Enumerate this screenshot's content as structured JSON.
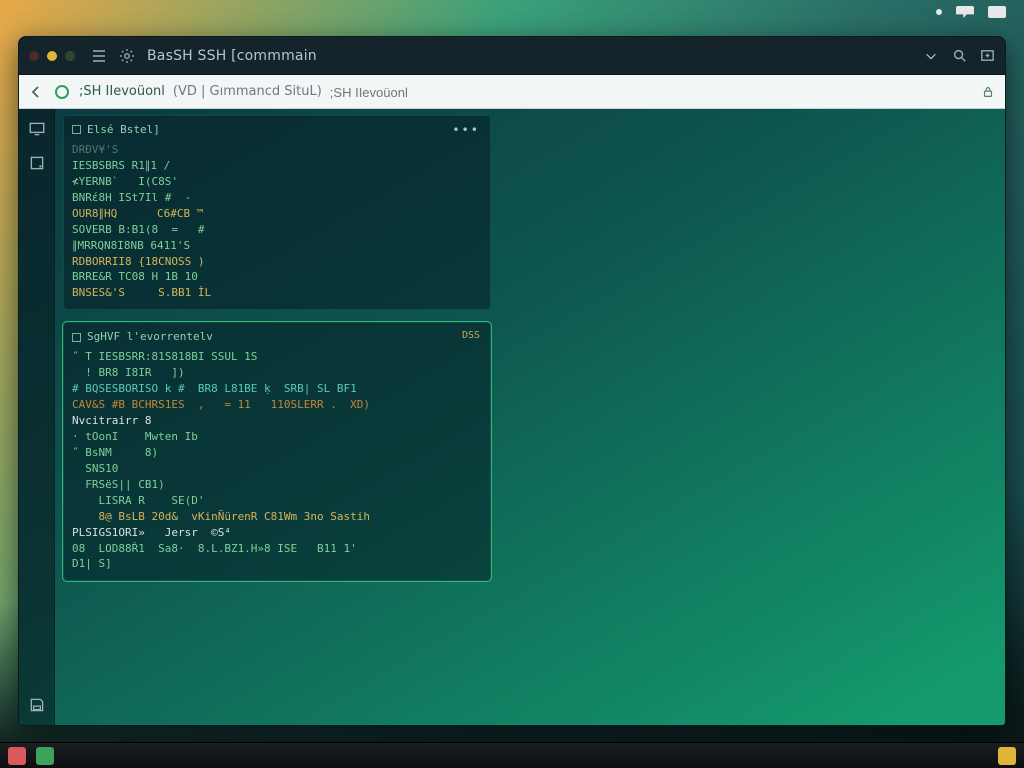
{
  "systray": {
    "items": [
      "dot",
      "chat",
      "screen"
    ]
  },
  "window": {
    "titlebar": {
      "title": "BasSH SSH [commmain",
      "icons": {
        "menu": "hamburger-icon",
        "gear": "gear-icon",
        "dropdown": "chevron-down-icon",
        "search": "search-icon",
        "newtab": "new-tab-icon"
      }
    },
    "addrbar": {
      "back": "back",
      "text_a": ";SH IIevoüonl",
      "text_b": "(VD | Gımmancd SituL)",
      "right_icon": "lock-icon"
    },
    "rail": {
      "items": [
        "monitor-icon",
        "disk-icon"
      ],
      "bottom": "save-icon"
    },
    "panes": [
      {
        "id": "p1",
        "title": "Elsé Bstel]",
        "menu": "...",
        "lines": [
          {
            "cls": "c-dim",
            "t": "DRÐV¥'S"
          },
          {
            "cls": "c-grn",
            "t": "IESBSBRS R1∥1 /"
          },
          {
            "cls": "c-grn",
            "t": "≮YERNB`   I(C8S'"
          },
          {
            "cls": "c-grn",
            "t": "BNRέ8H ISt7Il #  -"
          },
          {
            "cls": "c-yel",
            "t": "OUR8∥HQ      C6#CB ™"
          },
          {
            "cls": "c-grn",
            "t": "SOVERB B:B1(8  =   #"
          },
          {
            "cls": "c-grn",
            "t": "∥MRRQN8I8NB 6411'S"
          },
          {
            "cls": "c-yel",
            "t": "RDBORRII8 {18CNOSS )"
          },
          {
            "cls": "c-grn",
            "t": "BRRE&R TC08 H 1B 10"
          },
          {
            "cls": "c-yel",
            "t": "BNSES&'S     S.BB1 ÌL"
          }
        ]
      },
      {
        "id": "p2",
        "title": "SgHVF l'evorrentelv",
        "badge": "DSS",
        "lines": [
          {
            "cls": "c-grn",
            "t": "˝ T IESBSRR:81S818BI SSUL 1S"
          },
          {
            "cls": "c-grn",
            "t": "  ! BR8 I8IR   ])"
          },
          {
            "cls": "c-dim",
            "t": ""
          },
          {
            "cls": "c-cyan",
            "t": "# BQSESBORISO k #  BR8 L81BE ḳ  SRB| SL BF1"
          },
          {
            "cls": "c-org",
            "t": "CAV&S #B BCHRS1ES  ,   = 11   110SLERR .  XD)"
          },
          {
            "cls": "c-white",
            "t": "Nvcitrairr 8"
          },
          {
            "cls": "c-grn",
            "t": "· tOonI    Mwten Ib"
          },
          {
            "cls": "c-grn",
            "t": "˝ BsNM     8)"
          },
          {
            "cls": "c-grn",
            "t": "  SNS10"
          },
          {
            "cls": "c-grn",
            "t": "  FRSëS|| CB1)"
          },
          {
            "cls": "c-grn",
            "t": "    LISRA R    SE(D'"
          },
          {
            "cls": "c-yel",
            "t": "    8@ BsLB 20d&  vKinÑürenR C81Wm 3no Sastih"
          },
          {
            "cls": "c-white",
            "t": "PLSIGS1ORI»   Jersr  ©S⁴"
          },
          {
            "cls": "c-grn",
            "t": "08  LOD88Ŕ1  Sa8·  8.L.BZ1.H»8 ISE   B11 1'"
          },
          {
            "cls": "c-grn",
            "t": "D1| S]"
          }
        ]
      }
    ]
  },
  "taskbar": {
    "left": [
      "app-a",
      "app-b"
    ],
    "right": [
      "note"
    ]
  }
}
